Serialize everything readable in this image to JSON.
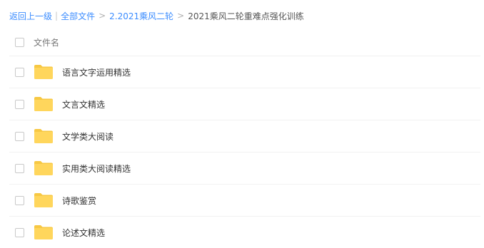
{
  "breadcrumb": {
    "back": "返回上一级",
    "all_files": "全部文件",
    "parent": "2.2021乘风二轮",
    "current": "2021乘风二轮重难点强化训练"
  },
  "header": {
    "column_name": "文件名"
  },
  "files": [
    {
      "name": "语言文字运用精选",
      "icon": "folder-icon"
    },
    {
      "name": "文言文精选",
      "icon": "folder-icon"
    },
    {
      "name": "文学类大阅读",
      "icon": "folder-icon"
    },
    {
      "name": "实用类大阅读精选",
      "icon": "folder-icon"
    },
    {
      "name": "诗歌鉴赏",
      "icon": "folder-icon"
    },
    {
      "name": "论述文精选",
      "icon": "folder-icon"
    }
  ],
  "colors": {
    "link": "#3b8cff",
    "folder": "#ffd65c",
    "folder_tab": "#f7c843"
  }
}
